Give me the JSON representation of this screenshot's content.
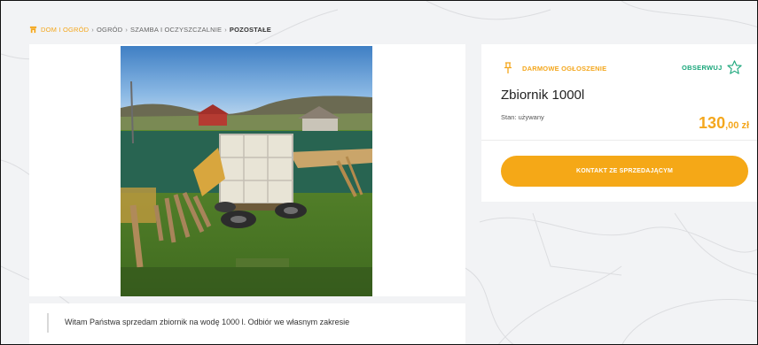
{
  "breadcrumb": {
    "items": [
      "DOM I OGRÓD",
      "OGRÓD",
      "SZAMBA I OCZYSZCZALNIE",
      "POZOSTAŁE"
    ],
    "separator": "›"
  },
  "listing": {
    "badge": "DARMOWE OGŁOSZENIE",
    "watch_label": "OBSERWUJ",
    "title": "Zbiornik 1000l",
    "condition": "Stan: używany",
    "price_main": "130",
    "price_decimals": ",00 zł",
    "contact_label": "KONTAKT ZE SPRZEDAJĄCYM"
  },
  "description": {
    "text": "Witam Państwa sprzedam zbiornik na wodę 1000 l. Odbiór we własnym zakresie"
  },
  "icons": {
    "home": "home-icon",
    "pin": "pin-icon",
    "star": "star-outline-icon"
  },
  "colors": {
    "accent": "#f5a817",
    "watch": "#19a67a"
  }
}
